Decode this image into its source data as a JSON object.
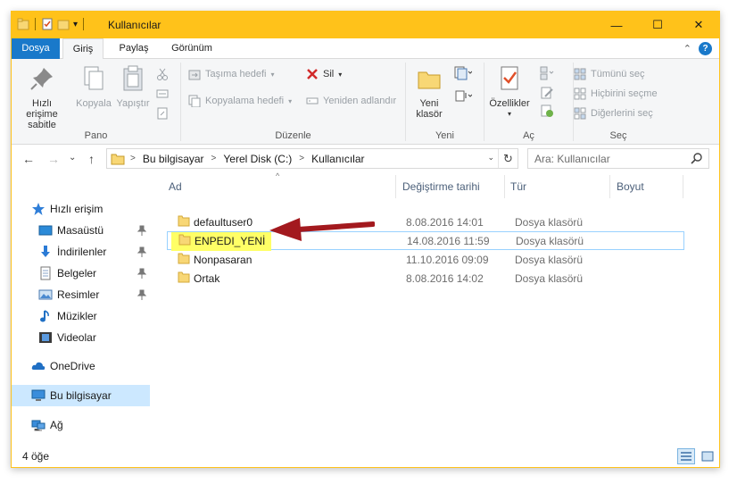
{
  "window": {
    "title": "Kullanıcılar",
    "controls": {
      "minimize": "—",
      "maximize": "☐",
      "close": "✕"
    }
  },
  "qat": {
    "dropdown": "▾"
  },
  "ribbon_tabs": [
    {
      "label": "Dosya"
    },
    {
      "label": "Giriş"
    },
    {
      "label": "Paylaş"
    },
    {
      "label": "Görünüm"
    }
  ],
  "ribbon_right": {
    "collapse": "⌃",
    "help": "?"
  },
  "ribbon": {
    "pano": {
      "label": "Pano",
      "pin": "Hızlı erişime\nsabitle",
      "copy": "Kopyala",
      "paste": "Yapıştır"
    },
    "duzenle": {
      "label": "Düzenle",
      "move_to": "Taşıma hedefi",
      "copy_to": "Kopyalama hedefi",
      "delete": "Sil",
      "rename": "Yeniden adlandır"
    },
    "yeni": {
      "label": "Yeni",
      "new_folder": "Yeni\nklasör"
    },
    "ac": {
      "label": "Aç",
      "properties": "Özellikler"
    },
    "sec": {
      "label": "Seç",
      "select_all": "Tümünü seç",
      "select_none": "Hiçbirini seçme",
      "invert": "Diğerlerini seç"
    }
  },
  "address": {
    "back": "←",
    "forward": "→",
    "recent": "⌄",
    "up": "↑",
    "crumbs": [
      "Bu bilgisayar",
      "Yerel Disk (C:)",
      "Kullanıcılar"
    ],
    "separator": ">",
    "dropdown": "⌄",
    "refresh": "↻",
    "search_placeholder": "Ara: Kullanıcılar"
  },
  "navigation": {
    "quick_access": "Hızlı erişim",
    "items": [
      {
        "label": "Masaüstü",
        "icon": "desktop-icon"
      },
      {
        "label": "İndirilenler",
        "icon": "download-icon"
      },
      {
        "label": "Belgeler",
        "icon": "documents-icon"
      },
      {
        "label": "Resimler",
        "icon": "pictures-icon"
      },
      {
        "label": "Müzikler",
        "icon": "music-icon"
      },
      {
        "label": "Videolar",
        "icon": "videos-icon"
      }
    ],
    "onedrive": "OneDrive",
    "this_pc": "Bu bilgisayar",
    "network": "Ağ"
  },
  "columns": {
    "name": "Ad",
    "date": "Değiştirme tarihi",
    "type": "Tür",
    "size": "Boyut",
    "sort_indicator": "^"
  },
  "files": [
    {
      "name": "defaultuser0",
      "date": "8.08.2016 14:01",
      "type": "Dosya klasörü"
    },
    {
      "name": "ENPEDI_YENİ",
      "date": "14.08.2016 11:59",
      "type": "Dosya klasörü"
    },
    {
      "name": "Nonpasaran",
      "date": "11.10.2016 09:09",
      "type": "Dosya klasörü"
    },
    {
      "name": "Ortak",
      "date": "8.08.2016 14:02",
      "type": "Dosya klasörü"
    }
  ],
  "highlight_color": "#ffff66",
  "arrow_color": "#a3191e",
  "status": {
    "item_count": "4 öğe"
  }
}
